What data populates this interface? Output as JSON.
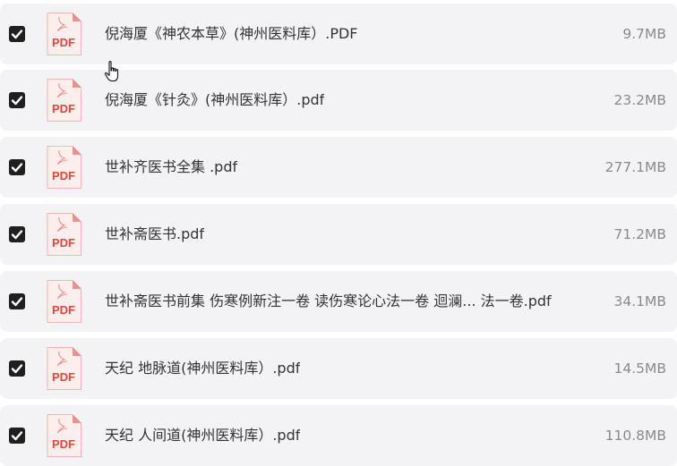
{
  "files": [
    {
      "name": "倪海厦《神农本草》(神州医料库）.PDF",
      "size": "9.7MB",
      "checked": true
    },
    {
      "name": "倪海厦《针灸》(神州医料库）.pdf",
      "size": "23.2MB",
      "checked": true
    },
    {
      "name": "世补齐医书全集 .pdf",
      "size": "277.1MB",
      "checked": true
    },
    {
      "name": "世补斋医书.pdf",
      "size": "71.2MB",
      "checked": true
    },
    {
      "name": "世补斋医书前集 伤寒例新注一卷 读伤寒论心法一卷 迴澜... 法一卷.pdf",
      "size": "34.1MB",
      "checked": true
    },
    {
      "name": "天纪 地脉道(神州医料库）.pdf",
      "size": "14.5MB",
      "checked": true
    },
    {
      "name": "天纪 人间道(神州医料库）.pdf",
      "size": "110.8MB",
      "checked": true
    }
  ],
  "icon": {
    "type": "pdf-file-icon",
    "label": "PDF",
    "accent": "#e0463c",
    "page_bg": "#fdeeee"
  },
  "colors": {
    "row_bg": "#f3f3f5",
    "checkbox": "#1f1f1f",
    "name_text": "#333333",
    "size_text": "#8a8a8a"
  },
  "cursor": "hand-pointer-icon"
}
